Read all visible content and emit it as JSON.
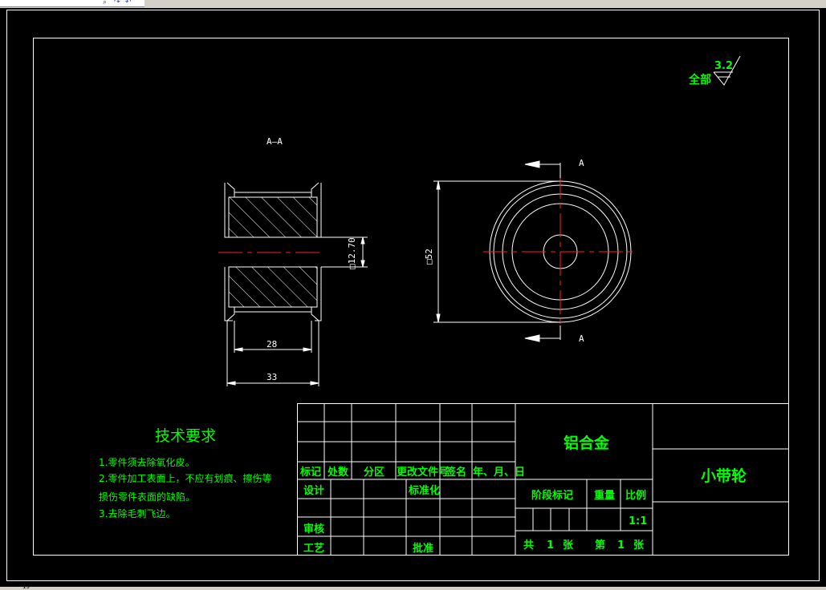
{
  "toolbar": {
    "icons": [
      "zoom-icon",
      "redo-icon",
      "undo-icon"
    ]
  },
  "drawing": {
    "roughness": {
      "prefix": "全部",
      "value": "3.2"
    },
    "section_label": "A—A",
    "cut_label_top": "A",
    "cut_label_bottom": "A",
    "dim_bore": "□12.70",
    "dim_outer": "□52",
    "dim_width_inner": "28",
    "dim_width_outer": "33"
  },
  "tech": {
    "title": "技术要求",
    "items": [
      "1.零件须去除氧化皮。",
      "2.零件加工表面上，不应有划痕、擦伤等",
      "损伤零件表面的缺陷。",
      "3.去除毛刺飞边。"
    ]
  },
  "title_block": {
    "material": "铝合金",
    "part_name": "小带轮",
    "headers": [
      "标记",
      "处数",
      "分区",
      "更改文件号",
      "签名",
      "年、月、日"
    ],
    "design": "设计",
    "standardize": "标准化",
    "stage": "阶段标记",
    "weight": "重量",
    "scale_label": "比例",
    "scale_value": "1:1",
    "review": "审核",
    "process": "工艺",
    "approve": "批准",
    "sheets": [
      "共",
      "1",
      "张",
      "第",
      "1",
      "张"
    ]
  },
  "status": {
    "coord": "19"
  }
}
